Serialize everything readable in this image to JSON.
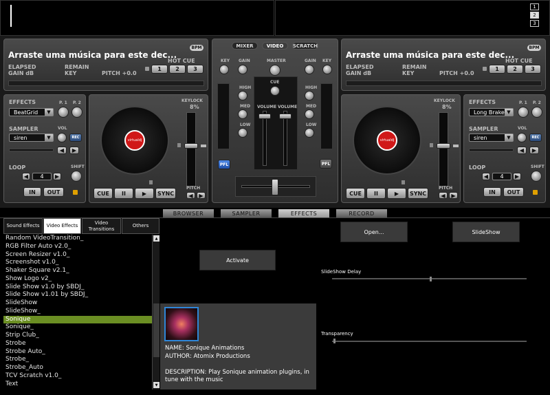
{
  "waveform": {
    "pages": [
      "1",
      "2",
      "3"
    ]
  },
  "deck_left": {
    "title": "Arraste uma música para este dec...",
    "bpm_badge": "BPM",
    "elapsed": "ELAPSED",
    "remain": "REMAIN",
    "gain_db": "GAIN dB",
    "key": "KEY",
    "pitch": "PITCH +0.0",
    "hot_cue_label": "HOT CUE",
    "hot_cues": [
      "1",
      "2",
      "3"
    ],
    "effects_label": "EFFECTS",
    "p1": "P. 1",
    "p2": "P. 2",
    "effect_selected": "BeatGrid",
    "sampler_label": "SAMPLER",
    "vol_label": "VOL",
    "sampler_selected": "siren",
    "rec_label": "REC",
    "loop_label": "LOOP",
    "shift_label": "SHIFT",
    "loop_value": "4",
    "in_label": "IN",
    "out_label": "OUT",
    "keylock_label": "KEYLOCK",
    "pitch_pct": "8%",
    "pitch_label": "PITCH",
    "cue_label": "CUE",
    "play_pause": "II",
    "play": "▶",
    "sync_label": "SYNC",
    "platter_label": "virtualdj"
  },
  "deck_right": {
    "title": "Arraste uma música para este dec...",
    "bpm_badge": "BPM",
    "elapsed": "ELAPSED",
    "remain": "REMAIN",
    "gain_db": "GAIN dB",
    "key": "KEY",
    "pitch": "PITCH +0.0",
    "hot_cue_label": "HOT CUE",
    "hot_cues": [
      "1",
      "2",
      "3"
    ],
    "effects_label": "EFFECTS",
    "p1": "P. 1",
    "p2": "P. 2",
    "effect_selected": "Long Brake",
    "sampler_label": "SAMPLER",
    "vol_label": "VOL",
    "sampler_selected": "siren",
    "rec_label": "REC",
    "loop_label": "LOOP",
    "shift_label": "SHIFT",
    "loop_value": "4",
    "in_label": "IN",
    "out_label": "OUT",
    "keylock_label": "KEYLOCK",
    "pitch_pct": "8%",
    "pitch_label": "PITCH",
    "cue_label": "CUE",
    "play_pause": "II",
    "play": "▶",
    "sync_label": "SYNC",
    "platter_label": "virtualdj"
  },
  "mixer": {
    "tabs": [
      "MIXER",
      "VIDEO",
      "SCRATCH"
    ],
    "active_tab": "VIDEO",
    "key": "KEY",
    "gain": "GAIN",
    "master": "MASTER",
    "cue": "CUE",
    "high": "HIGH",
    "med": "MED",
    "low": "LOW",
    "volume": "VOLUME",
    "pfl": "PFL"
  },
  "bottom_tabs": [
    "BROWSER",
    "SAMPLER",
    "EFFECTS",
    "RECORD"
  ],
  "active_bottom_tab": "EFFECTS",
  "effect_categories": [
    "Sound Effects",
    "Video Effects",
    "Video Transitions",
    "Others"
  ],
  "active_category": "Video Effects",
  "effects_list": [
    "Random VideoTransition_",
    "RGB Filter Auto v2.0_",
    "Screen Resizer v1.0_",
    "Screenshot v1.0_",
    "Shaker Square v2.1_",
    "Show Logo v2_",
    "Slide Show v1.0 by SBDJ_",
    "Slide Show v1.01 by SBDJ_",
    "SlideShow",
    "SlideShow_",
    "Sonique",
    "Sonique_",
    "Strip Club_",
    "Strobe",
    "Strobe Auto_",
    "Strobe_",
    "Strobe_Auto",
    "TCV Scratch v1.0_",
    "Text"
  ],
  "selected_effect": "Sonique",
  "activate_button": "Activate",
  "info": {
    "name": "NAME: Sonique Animations",
    "author": "AUTHOR: Atomix Productions",
    "description_line1": "DESCRIPTION: Play Sonique animation plugins, in",
    "description_line2": "tune with the music"
  },
  "open_button": "Open...",
  "slideshow_button": "SlideShow",
  "slideshow_delay_label": "SlideShow Delay",
  "transparency_label": "Transparency",
  "slideshow_delay_value": 0.5,
  "transparency_value": 0.0,
  "colors": {
    "selected_item": "#6b8e23",
    "platter_label": "#d01818",
    "pfl": "#2f6fd1",
    "lock": "#e0a000"
  }
}
